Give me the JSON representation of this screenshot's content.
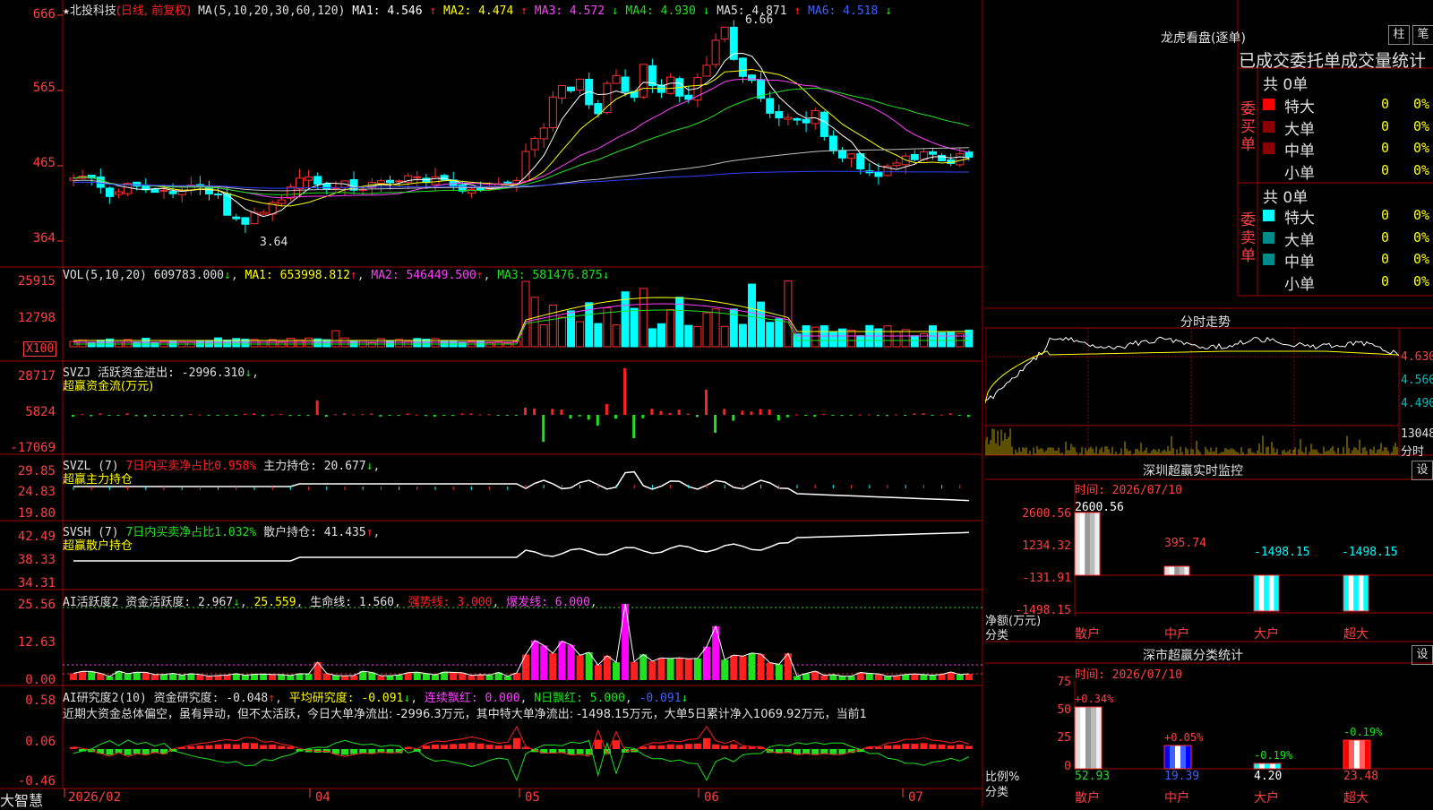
{
  "logo": "大智慧",
  "main": {
    "star": "★",
    "stock_name": "北投科技",
    "period": "(日线, 前复权)",
    "ma_params": "MA(5,10,20,30,60,120)",
    "ma_items": [
      {
        "label": "MA1: 4.546",
        "arrow": "↑",
        "color": "#ffffff"
      },
      {
        "label": "MA2: 4.474",
        "arrow": "↑",
        "color": "#ffff00"
      },
      {
        "label": "MA3: 4.572",
        "arrow": "↓",
        "color": "#ff40ff"
      },
      {
        "label": "MA4: 4.930",
        "arrow": "↓",
        "color": "#20e020"
      },
      {
        "label": "MA5: 4.871",
        "arrow": "↑",
        "color": "#e0e0e0"
      },
      {
        "label": "MA6: 4.518",
        "arrow": "↓",
        "color": "#4060ff"
      }
    ],
    "high_note": "6.66",
    "low_note": "3.64",
    "y_ticks": [
      "666",
      "565",
      "465",
      "364"
    ]
  },
  "vol": {
    "header": "VOL(5,10,20) 609783.000",
    "arrow0": "↓",
    "ma1": "MA1: 653998.812",
    "arrow1": "↑",
    "ma2": "MA2: 546449.500",
    "arrow2": "↑",
    "ma3": "MA3: 581476.875",
    "arrow3": "↓",
    "y_ticks": [
      "25915",
      "12798"
    ],
    "unit": "X100"
  },
  "svzj": {
    "header": "SVZJ  活跃资金进出: -2996.310",
    "arrow": "↓",
    "sub": "超赢资金流(万元)",
    "y_ticks": [
      "28717",
      "5824",
      "-17069"
    ]
  },
  "svzl": {
    "name": "SVZL (7)",
    "ratio": "7日内买卖净占比0.958%",
    "hold": "主力持仓: 20.677",
    "arrow": "↓",
    "sub": "超赢主力持仓",
    "y_ticks": [
      "29.85",
      "24.83",
      "19.80"
    ]
  },
  "svsh": {
    "name": "SVSH (7)",
    "ratio": "7日内买卖净占比1.032%",
    "hold": "散户持仓: 41.435",
    "arrow": "↑",
    "sub": "超赢散户持仓",
    "y_ticks": [
      "42.49",
      "38.33",
      "34.31"
    ]
  },
  "ai1": {
    "name": "AI活跃度2",
    "v1": "资金活跃度: 2.967",
    "a1": "↓",
    "v2": "25.559",
    "v3": "生命线: 1.560",
    "v4": "强势线: 3.000",
    "v5": "爆发线: 6.000",
    "y_ticks": [
      "25.56",
      "12.63",
      "0.00"
    ]
  },
  "ai2": {
    "name": "AI研究度2(10)",
    "v1": "资金研究度: -0.048",
    "a1": "↑",
    "v2": "平均研究度: -0.091",
    "a2": "↓",
    "v3": "连续飘红: 0.000",
    "v4": "N日飘红: 5.000",
    "v5": "-0.091",
    "a5": "↓",
    "comment": "近期大资金总体偏空，虽有异动，但不太活跃，今日大单净流出: -2996.3万元，其中特大单净流出: -1498.15万元，大单5日累计净入1069.92万元，当前1",
    "y_ticks": [
      "0.58",
      "0.06",
      "-0.46"
    ]
  },
  "dates": [
    "2026/02",
    "04",
    "05",
    "06",
    "07"
  ],
  "lhb": {
    "title": "龙虎看盘(逐单)",
    "btn1": "柱",
    "btn2": "笔",
    "subtitle": "已成交委托单成交量统计",
    "buy_label": "委买单",
    "sell_label": "委卖单",
    "buy_total": "共 0单",
    "sell_total": "共 0单",
    "rows": [
      {
        "name": "特大",
        "val": "0",
        "pct": "0%"
      },
      {
        "name": "大单",
        "val": "0",
        "pct": "0%"
      },
      {
        "name": "中单",
        "val": "0",
        "pct": "0%"
      },
      {
        "name": "小单",
        "val": "0",
        "pct": "0%"
      }
    ]
  },
  "fenshi": {
    "title": "分时走势",
    "y_ticks": [
      "4.630",
      "4.560",
      "4.490"
    ],
    "vol_tick": "13048",
    "unit": "分时"
  },
  "sz_monitor": {
    "title": "深圳超赢实时监控",
    "btn": "设",
    "time": "时间: 2026/07/10",
    "y_ticks": [
      "2600.56",
      "1234.32",
      "-131.91",
      "-1498.15"
    ],
    "y_unit": "净额(万元)",
    "x_unit": "分类",
    "cats": [
      "散户",
      "中户",
      "大户",
      "超大"
    ],
    "values": [
      "2600.56",
      "395.74",
      "-1498.15",
      "-1498.15"
    ]
  },
  "sz_class": {
    "title": "深市超赢分类统计",
    "btn": "设",
    "time": "时间: 2026/07/10",
    "y_ticks": [
      "75",
      "50",
      "25",
      "0"
    ],
    "y_unit": "比例%",
    "x_unit": "分类",
    "cats": [
      "散户",
      "中户",
      "大户",
      "超大"
    ],
    "changes": [
      "+0.34%",
      "+0.05%",
      "-0.19%",
      "-0.19%"
    ],
    "values": [
      "52.93",
      "19.39",
      "4.20",
      "23.48"
    ]
  },
  "chart_data": {
    "type": "line",
    "title": "北投科技 (日线, 前复权)",
    "ylim": [
      3.64,
      6.66
    ],
    "ma_values": {
      "MA1": 4.546,
      "MA2": 4.474,
      "MA3": 4.572,
      "MA4": 4.93,
      "MA5": 4.871,
      "MA6": 4.518
    },
    "x_ticks": [
      "2026/02",
      "04",
      "05",
      "06",
      "07"
    ],
    "sz_monitor_values": [
      2600.56,
      395.74,
      -1498.15,
      -1498.15
    ],
    "sz_class_values": [
      52.93,
      19.39,
      4.2,
      23.48
    ]
  }
}
